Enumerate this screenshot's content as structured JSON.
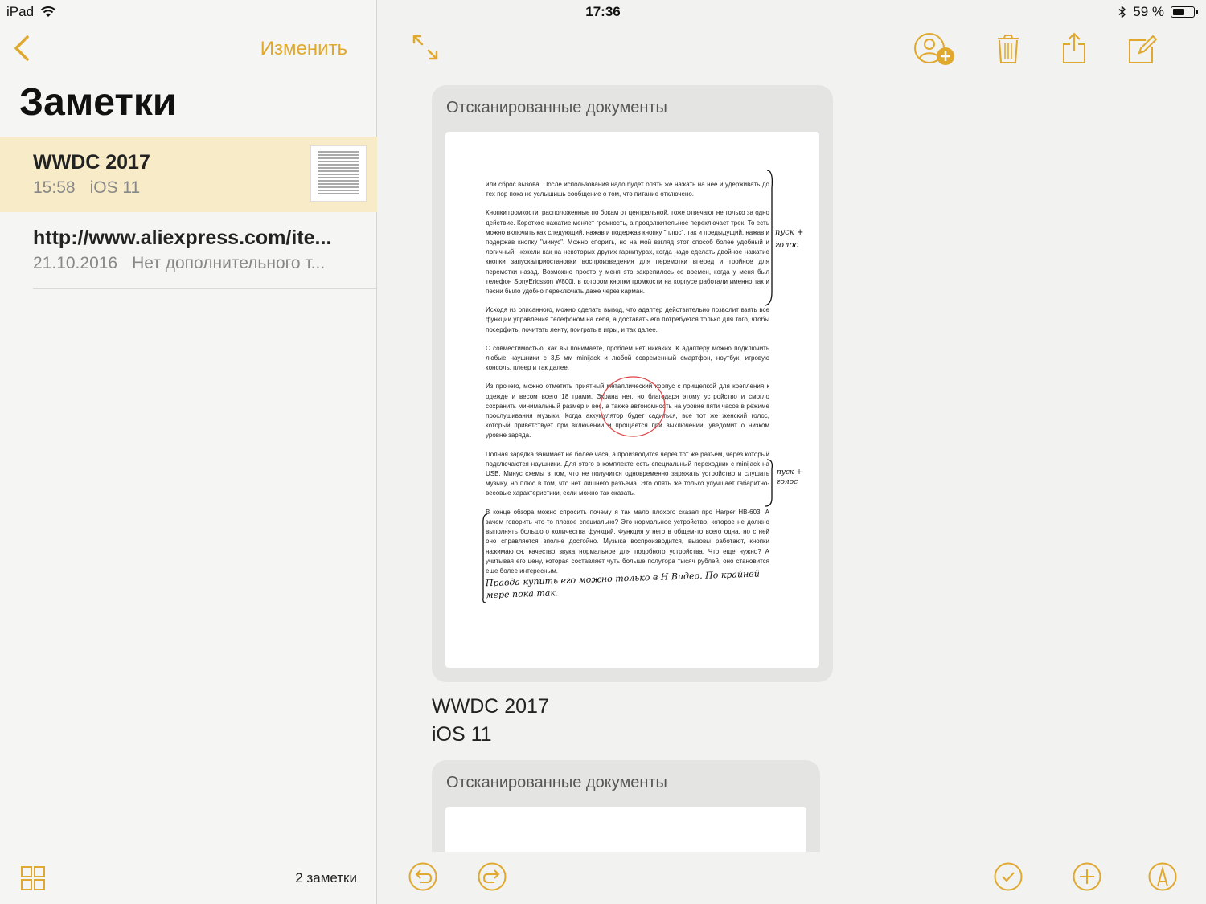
{
  "status": {
    "device": "iPad",
    "time": "17:36",
    "battery": "59 %",
    "battery_level": 0.59
  },
  "sidebar": {
    "title": "Заметки",
    "edit_label": "Изменить",
    "notes": [
      {
        "title": "WWDC 2017",
        "date": "15:58",
        "subtitle": "iOS 11"
      },
      {
        "title": "http://www.aliexpress.com/ite...",
        "date": "21.10.2016",
        "subtitle": "Нет дополнительного т..."
      }
    ],
    "count_label": "2 заметки"
  },
  "note": {
    "scan_label_1": "Отсканированные документы",
    "scan_label_2": "Отсканированные документы",
    "line1": "WWDC 2017",
    "line2": "iOS 11",
    "scan_paragraphs": [
      "или сброс вызова. После использования надо будет опять же нажать на нее и удерживать до тех пор пока не услышишь сообщение о том, что питание отключено.",
      "Кнопки громкости, расположенные по бокам от центральной, тоже отвечают не только за одно действие. Короткое нажатие меняет громкость, а продолжительное переключает трек. То есть можно включить как следующий, нажав и подержав кнопку \"плюс\", так и предыдущий, нажав и подержав кнопку \"минус\". Можно спорить, но на мой взгляд этот способ более удобный и логичный, нежели как на некоторых других гарнитурах, когда надо сделать двойное нажатие кнопки запуска/приостановки воспроизведения для перемотки вперед и тройное для перемотки назад. Возможно просто у меня это закрепилось со времен, когда у меня был телефон SonyEricsson W800i, в котором кнопки громкости на корпусе работали именно так и песни было удобно переключать даже через карман.",
      "Исходя из описанного, можно сделать вывод, что адаптер действительно позволит взять все функции управления телефоном на себя, а доставать его потребуется только для того, чтобы посерфить, почитать ленту, поиграть в игры, и так далее.",
      "С совместимостью, как вы понимаете, проблем нет никаких. К адаптеру можно подключить любые наушники с 3,5 мм minijack и любой современный смартфон, ноутбук, игровую консоль, плеер и так далее.",
      "Из прочего, можно отметить приятный металлический корпус с прищепкой для крепления к одежде и весом всего 18 грамм. Экрана нет, но благодаря этому устройство и смогло сохранить минимальный размер и вес, а также автономность на уровне пяти часов в режиме прослушивания музыки. Когда аккумулятор будет садиться, все тот же женский голос, который приветствует при включении и прощается при выключении, уведомит о низком уровне заряда.",
      "Полная зарядка занимает не более часа, а производится через тот же разъем, через который подключаются наушники. Для этого в комплекте есть специальный переходник с minijack на USB. Минус схемы в том, что не получится одновременно заряжать устройство и слушать музыку, но плюс в том, что нет лишнего разъема. Это опять же только улучшает габаритно-весовые характеристики, если можно так сказать.",
      "В конце обзора можно спросить почему я так мало плохого сказал про Harper HB-603. А зачем говорить что-то плохое специально? Это нормальное устройство, которое не должно выполнять большого количества функций. Функция у него в общем-то всего одна, но с ней оно справляется вполне достойно. Музыка воспроизводится, вызовы работают, кнопки нажимаются, качество звука нормальное для подобного устройства. Что еще нужно? А учитывая его цену, которая составляет чуть больше полутора тысяч рублей, оно становится еще более интересным."
    ],
    "hand_note_1": "пуск + голос",
    "hand_note_2": "пуск + голос",
    "hand_note_3": "Правда купить его можно только в H Видео. По крайней мере пока так."
  },
  "colors": {
    "accent": "#e0a82e",
    "selected_row": "#f8ebc8",
    "card": "#e4e4e2"
  },
  "icons": {
    "back": "chevron-left-icon",
    "expand": "expand-arrows-icon",
    "add_people": "add-person-icon",
    "trash": "trash-icon",
    "share": "share-icon",
    "compose": "compose-icon",
    "grid": "grid-icon",
    "undo": "undo-icon",
    "redo": "redo-icon",
    "checklist": "checklist-icon",
    "add": "plus-circle-icon",
    "markup": "markup-pen-icon"
  }
}
